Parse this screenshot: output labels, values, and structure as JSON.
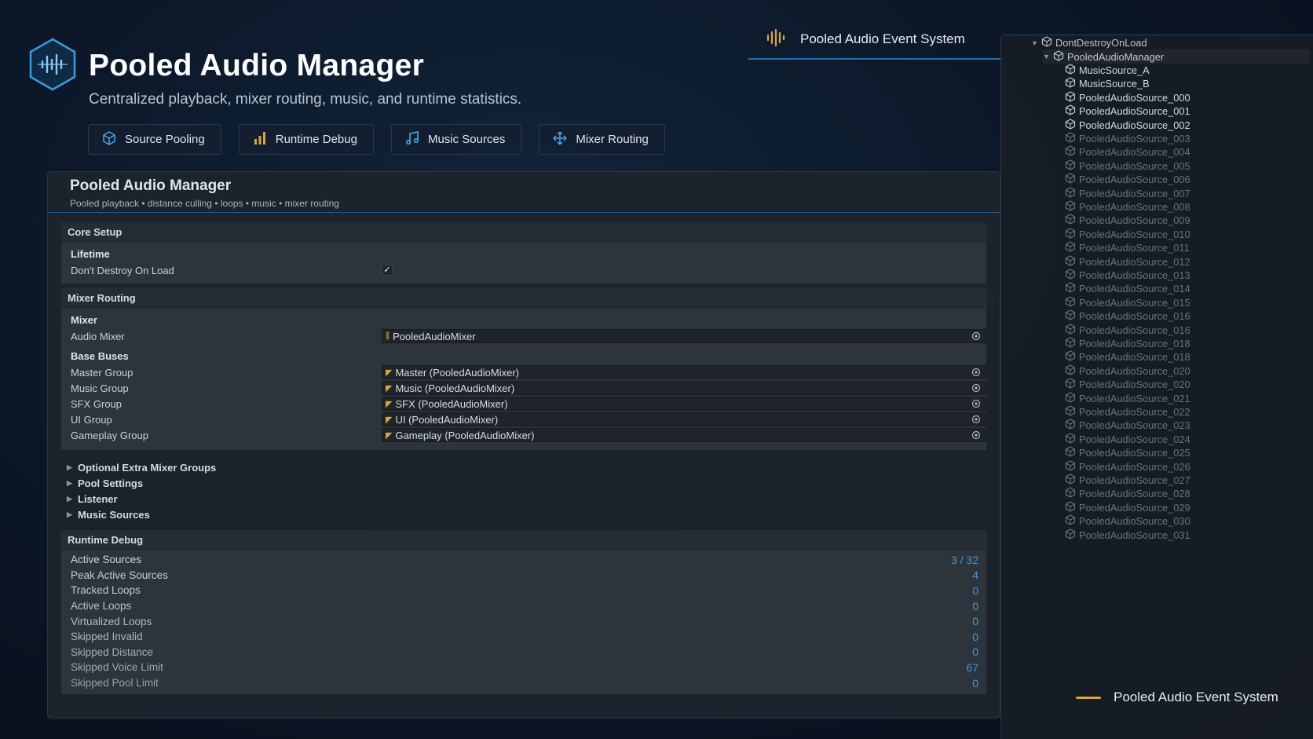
{
  "header": {
    "title": "Pooled Audio Manager",
    "subtitle": "Centralized playback, mixer routing, music, and runtime statistics."
  },
  "feature_tabs": [
    {
      "label": "Source Pooling",
      "icon": "cube-icon"
    },
    {
      "label": "Runtime Debug",
      "icon": "bar-chart-icon"
    },
    {
      "label": "Music Sources",
      "icon": "music-note-icon"
    },
    {
      "label": "Mixer Routing",
      "icon": "arrows-move-icon"
    }
  ],
  "top_banner": {
    "label": "Pooled Audio Event System",
    "icon": "audio-wave-icon"
  },
  "bottom_banner": {
    "label": "Pooled Audio Event System"
  },
  "inspector": {
    "title": "Pooled Audio Manager",
    "subtitle": "Pooled playback • distance culling • loops • music • mixer routing",
    "core_setup": {
      "header": "Core Setup",
      "lifetime_header": "Lifetime",
      "dont_destroy_label": "Don't Destroy On Load",
      "dont_destroy_checked": true
    },
    "mixer_routing": {
      "header": "Mixer Routing",
      "mixer_header": "Mixer",
      "audio_mixer_label": "Audio Mixer",
      "audio_mixer_value": "PooledAudioMixer",
      "base_buses_header": "Base Buses",
      "buses": [
        {
          "label": "Master Group",
          "value": "Master (PooledAudioMixer)"
        },
        {
          "label": "Music Group",
          "value": "Music (PooledAudioMixer)"
        },
        {
          "label": "SFX Group",
          "value": "SFX (PooledAudioMixer)"
        },
        {
          "label": "UI Group",
          "value": "UI (PooledAudioMixer)"
        },
        {
          "label": "Gameplay Group",
          "value": "Gameplay (PooledAudioMixer)"
        }
      ]
    },
    "foldouts": [
      "Optional Extra Mixer Groups",
      "Pool Settings",
      "Listener",
      "Music Sources"
    ],
    "runtime_debug": {
      "header": "Runtime Debug",
      "stats": [
        {
          "label": "Active Sources",
          "value": "3 / 32"
        },
        {
          "label": "Peak Active Sources",
          "value": "4"
        },
        {
          "label": "Tracked Loops",
          "value": "0"
        },
        {
          "label": "Active Loops",
          "value": "0"
        },
        {
          "label": "Virtualized Loops",
          "value": "0"
        },
        {
          "label": "Skipped Invalid",
          "value": "0"
        },
        {
          "label": "Skipped Distance",
          "value": "0"
        },
        {
          "label": "Skipped Voice Limit",
          "value": "67"
        },
        {
          "label": "Skipped Pool Limit",
          "value": "0"
        }
      ]
    }
  },
  "hierarchy": {
    "root": "DontDestroyOnLoad",
    "manager": "PooledAudioManager",
    "active_children": [
      "MusicSource_A",
      "MusicSource_B",
      "PooledAudioSource_000",
      "PooledAudioSource_001",
      "PooledAudioSource_002"
    ],
    "inactive_children": [
      "PooledAudioSource_003",
      "PooledAudioSource_004",
      "PooledAudioSource_005",
      "PooledAudioSource_006",
      "PooledAudioSource_007",
      "PooledAudioSource_008",
      "PooledAudioSource_009",
      "PooledAudioSource_010",
      "PooledAudioSource_011",
      "PooledAudioSource_012",
      "PooledAudioSource_013",
      "PooledAudioSource_014",
      "PooledAudioSource_015",
      "PooledAudioSource_016",
      "PooledAudioSource_016",
      "PooledAudioSource_018",
      "PooledAudioSource_018",
      "PooledAudioSource_020",
      "PooledAudioSource_020",
      "PooledAudioSource_021",
      "PooledAudioSource_022",
      "PooledAudioSource_023",
      "PooledAudioSource_024",
      "PooledAudioSource_025",
      "PooledAudioSource_026",
      "PooledAudioSource_027",
      "PooledAudioSource_028",
      "PooledAudioSource_029",
      "PooledAudioSource_030",
      "PooledAudioSource_031"
    ]
  },
  "colors": {
    "accent_blue": "#3e97e0",
    "accent_orange": "#e1a23a",
    "text_active": "#d6dde6",
    "text_inactive": "#6c7682"
  }
}
